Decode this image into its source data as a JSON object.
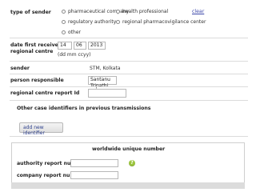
{
  "type_of_sender": {
    "label": "type of sender",
    "options": [
      {
        "label": "pharmaceutical company"
      },
      {
        "label": "health professional"
      },
      {
        "label": "regulatory authority"
      },
      {
        "label": "regional pharmacovigilance center"
      },
      {
        "label": "other"
      }
    ],
    "clear_link": "clear"
  },
  "date_received": {
    "label_line1": "date first received at",
    "label_line2": "regional centre",
    "day": "14",
    "month": "06",
    "year": "2013",
    "format_hint": "(dd mm ccyy)"
  },
  "sender": {
    "label": "sender",
    "value": "STM, Kolkata"
  },
  "person_responsible": {
    "label": "person responsible",
    "value": "Santanu Tripathi"
  },
  "regional_report_id": {
    "label": "regional centre report Id",
    "value": ""
  },
  "other_ids": {
    "label": "Other case identifiers in previous transmissions"
  },
  "add_identifier_button": "add new identifier",
  "worldwide": {
    "heading": "worldwide unique number",
    "authority_label": "authority report number",
    "company_label": "company report number",
    "authority_value": "",
    "company_value": "",
    "help_glyph": "?"
  }
}
